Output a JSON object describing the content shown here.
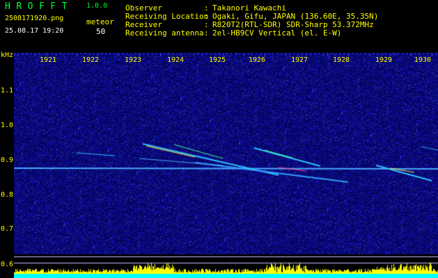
{
  "header": {
    "app_title": "HROFFT",
    "app_version": "1.0.0",
    "file_name": "2508171920.png",
    "date_time": "25.08.17 19:20",
    "meteor_label": "meteor",
    "meteor_count": "50"
  },
  "info": [
    {
      "key": "Observer",
      "sep": ":",
      "value": "Takanori Kawachi"
    },
    {
      "key": "Receiving Location",
      "sep": ":",
      "value": "Ogaki, Gifu, JAPAN (136.60E, 35.35N)"
    },
    {
      "key": "Receiver",
      "sep": ":",
      "value": "R820T2(RTL-SDR) SDR-Sharp 53.372MHz"
    },
    {
      "key": "Receiving antenna",
      "sep": ":",
      "value": "2el-HB9CV Vertical (el. E-W)"
    }
  ],
  "axes": {
    "unit": "kHz",
    "x_ticks": [
      "1921",
      "1922",
      "1923",
      "1924",
      "1925",
      "1926",
      "1927",
      "1928",
      "1929",
      "1930"
    ],
    "y_ticks": [
      "1.1",
      "1.0",
      "0.9",
      "0.8",
      "0.7",
      "0.6"
    ]
  },
  "colors": {
    "background": "#000000",
    "label_green": "#00ff33",
    "label_yellow": "#ffff00",
    "noise_floor": "#0a0a6e",
    "baseline_cyan": "#00ffff",
    "envelope_yellow": "#ffff00"
  }
}
